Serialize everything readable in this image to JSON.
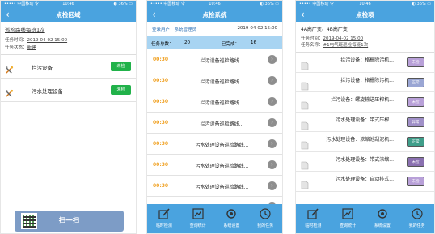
{
  "status": {
    "carrier": "••••• 中国移动 令",
    "time": "10:46",
    "battery": "◐ 36% ▭"
  },
  "phone1": {
    "title": "点检区域",
    "route": "巡检路线每班1次",
    "task_time_label": "任务时间：",
    "task_time": "2019-04-02 15:00",
    "task_status_label": "任务状态：",
    "task_status": "新建",
    "areas": [
      {
        "name": "拦污设备",
        "badge": "未检",
        "icon": "tools-icon"
      },
      {
        "name": "污水处理设备",
        "badge": "未检",
        "icon": "tools-icon"
      }
    ],
    "scan_label": "扫一扫"
  },
  "phone2": {
    "title": "点检系统",
    "user_label": "登录用户：",
    "user": "系统管理员",
    "date": "2019-04-02 15:00",
    "total_label": "任务总数：",
    "total": "20",
    "done_label": "已完成：",
    "done": "16",
    "tasks": [
      {
        "time": "00:30",
        "name": "拦污设备巡检路线..."
      },
      {
        "time": "00:30",
        "name": "拦污设备巡检路线..."
      },
      {
        "time": "00:30",
        "name": "拦污设备巡检路线..."
      },
      {
        "time": "00:30",
        "name": "拦污设备巡检路线..."
      },
      {
        "time": "00:30",
        "name": "污水处理设备巡检路线..."
      },
      {
        "time": "00:30",
        "name": "污水处理设备巡检路线..."
      },
      {
        "time": "00:30",
        "name": "污水处理设备巡检路线..."
      },
      {
        "time": "00:30",
        "name": "污水处理设备巡检路线..."
      }
    ]
  },
  "tabs": [
    {
      "label": "临时检测",
      "icon": "pencil-icon"
    },
    {
      "label": "查询统计",
      "icon": "stats-icon"
    },
    {
      "label": "系统设置",
      "icon": "settings-icon"
    },
    {
      "label": "我的任务",
      "icon": "task-icon"
    }
  ],
  "phone3": {
    "title": "点检项",
    "stations": "4A高厂变、4B高厂变",
    "task_time_label": "任务时间：",
    "task_time": "2019-04-02 15:00",
    "task_name_label": "任务名称：",
    "task_name": "#1电气班巡检每班1次",
    "points": [
      {
        "name": "拦污设备：格栅除污机...",
        "badge": "未检",
        "color": "#b8a0d8"
      },
      {
        "name": "拦污设备：格栅除污机...",
        "badge": "正常",
        "color": "#9aa6d4"
      },
      {
        "name": "拦污设备：螺旋输送压榨机...",
        "badge": "未检",
        "color": "#b8a0d8"
      },
      {
        "name": "污水处理设备：带式压榨...",
        "badge": "异常",
        "color": "#a090c8"
      },
      {
        "name": "污水处理设备：浓缩池刮泥机...",
        "badge": "正常",
        "color": "#3f9e8a"
      },
      {
        "name": "污水处理设备：带式浓缩...",
        "badge": "未检",
        "color": "#8a70b0"
      },
      {
        "name": "污水处理设备：自动排式...",
        "badge": "未检",
        "color": "#b8a0d8"
      }
    ]
  }
}
